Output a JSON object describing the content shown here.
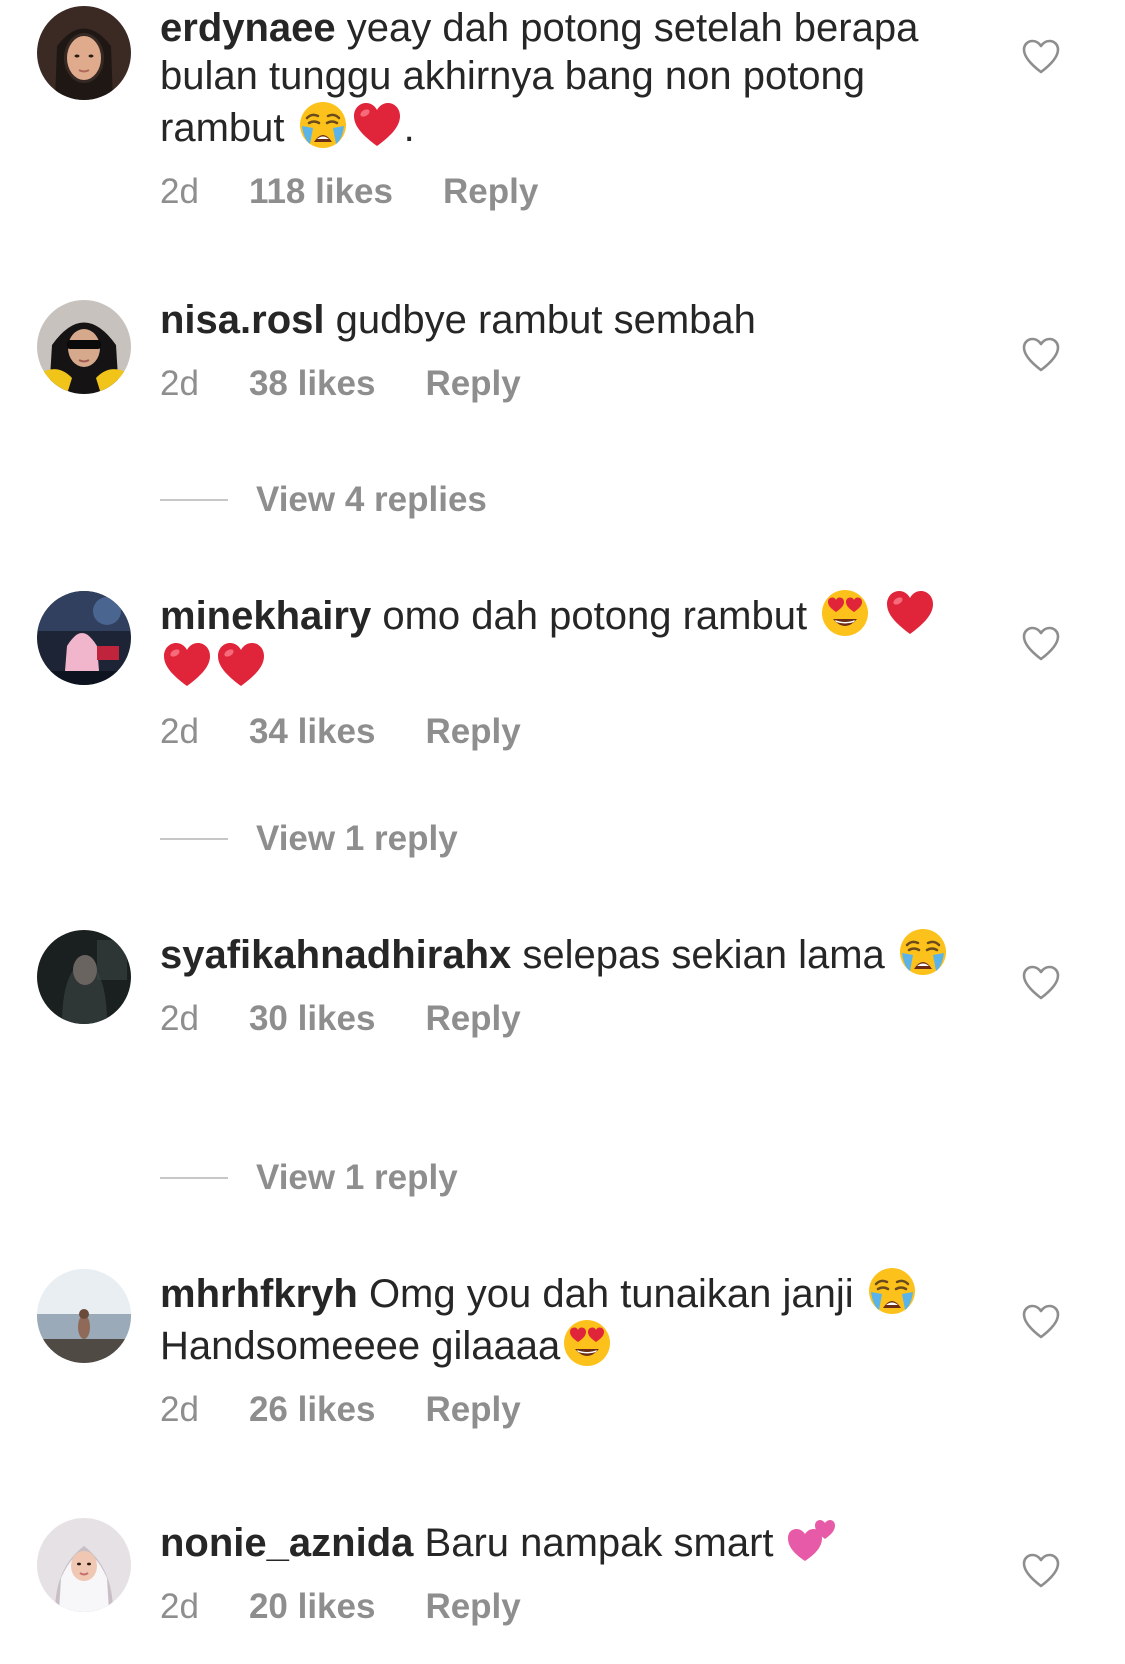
{
  "comments": [
    {
      "username": "erdynaee",
      "text_parts": [
        "yeay dah potong setelah berapa bulan tunggu akhirnya bang non potong rambut",
        "."
      ],
      "emojis": [
        "crying-face-emoji",
        "red-heart-emoji"
      ],
      "time": "2d",
      "likes": "118 likes",
      "reply": "Reply"
    },
    {
      "username": "nisa.rosl",
      "text": "gudbye rambut sembah",
      "time": "2d",
      "likes": "38 likes",
      "reply": "Reply",
      "view_replies": "View 4 replies"
    },
    {
      "username": "minekhairy",
      "text": "omo dah potong rambut",
      "emojis": [
        "heart-eyes-emoji",
        "red-heart-emoji",
        "red-heart-emoji",
        "red-heart-emoji"
      ],
      "time": "2d",
      "likes": "34 likes",
      "reply": "Reply",
      "view_replies": "View 1 reply"
    },
    {
      "username": "syafikahnadhirahx",
      "text": "selepas sekian lama",
      "emojis": [
        "crying-face-emoji"
      ],
      "time": "2d",
      "likes": "30 likes",
      "reply": "Reply",
      "view_replies": "View 1 reply"
    },
    {
      "username": "mhrhfkryh",
      "text_parts": [
        "Omg you dah tunaikan janji",
        "Handsomeeee gilaaaa"
      ],
      "emojis": [
        "crying-face-emoji",
        "heart-eyes-emoji"
      ],
      "time": "2d",
      "likes": "26 likes",
      "reply": "Reply"
    },
    {
      "username": "nonie_aznida",
      "text": "Baru nampak smart",
      "emojis": [
        "two-hearts-emoji"
      ],
      "time": "2d",
      "likes": "20 likes",
      "reply": "Reply"
    }
  ],
  "colors": {
    "text": "#262626",
    "secondary": "#8e8e8e",
    "heart_emoji": "#e0243a"
  },
  "icons": {
    "like": "heart-outline-icon"
  }
}
